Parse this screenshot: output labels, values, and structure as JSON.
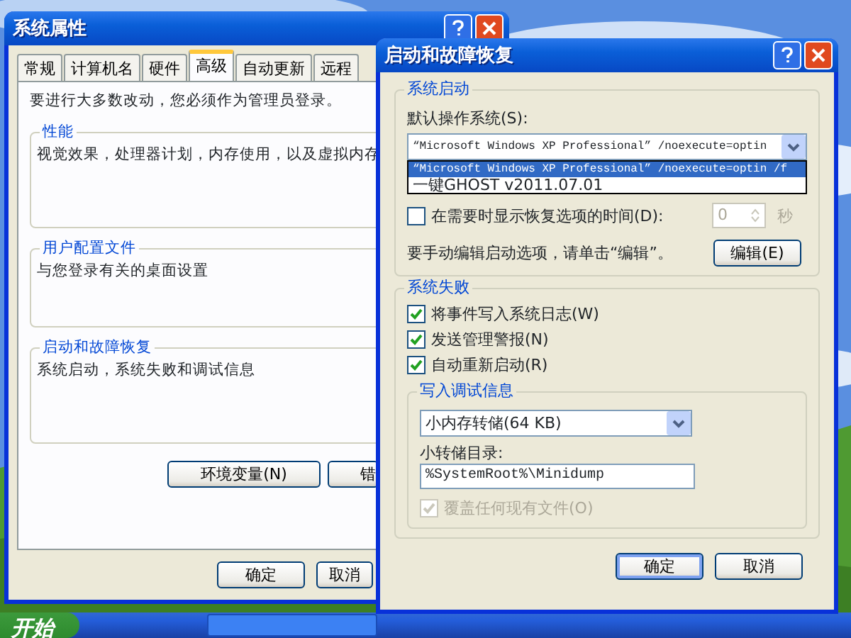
{
  "system_properties": {
    "title": "系统属性",
    "tabs": [
      {
        "label": "常规",
        "selected": false
      },
      {
        "label": "计算机名",
        "selected": false
      },
      {
        "label": "硬件",
        "selected": false
      },
      {
        "label": "高级",
        "selected": true
      },
      {
        "label": "自动更新",
        "selected": false
      },
      {
        "label": "远程",
        "selected": false
      }
    ],
    "notice": "要进行大多数改动，您必须作为管理员登录。",
    "groups": [
      {
        "title": "性能",
        "text": "视觉效果，处理器计划，内存使用，以及虚拟内存"
      },
      {
        "title": "用户配置文件",
        "text": "与您登录有关的桌面设置"
      },
      {
        "title": "启动和故障恢复",
        "text": "系统启动，系统失败和调试信息"
      }
    ],
    "buttons": [
      "环境变量(N)",
      "错"
    ],
    "footer_buttons": [
      "确定",
      "取消"
    ]
  },
  "startup_recovery": {
    "title": "启动和故障恢复",
    "system_startup": {
      "title": "系统启动",
      "default_os_label": "默认操作系统(S):",
      "default_os_value": "“Microsoft Windows XP Professional” /noexecute=optin",
      "dropdown_options": [
        {
          "label": "“Microsoft Windows XP Professional” /noexecute=optin /f",
          "selected": true
        },
        {
          "label": "一键GHOST v2011.07.01",
          "selected": false
        }
      ],
      "show_recovery": {
        "label": "在需要时显示恢复选项的时间(D):",
        "checked": false
      },
      "recovery_time": {
        "value": "0",
        "disabled": true
      },
      "seconds_label": "秒",
      "edit_hint": "要手动编辑启动选项，请单击“编辑”。",
      "edit_button": "编辑(E)"
    },
    "system_failure": {
      "title": "系统失败",
      "options": [
        {
          "label": "将事件写入系统日志(W)",
          "checked": true
        },
        {
          "label": "发送管理警报(N)",
          "checked": true
        },
        {
          "label": "自动重新启动(R)",
          "checked": true
        }
      ],
      "debug": {
        "title": "写入调试信息",
        "dump_type": "小内存转储(64 KB)",
        "dir_label": "小转储目录:",
        "dir_value": "%SystemRoot%\\Minidump",
        "overwrite": {
          "label": "覆盖任何现有文件(O)",
          "checked": true,
          "disabled": true
        }
      }
    },
    "buttons": [
      {
        "label": "确定",
        "default": true
      },
      {
        "label": "取消",
        "default": false
      }
    ]
  },
  "taskbar": {
    "start": "开始"
  }
}
